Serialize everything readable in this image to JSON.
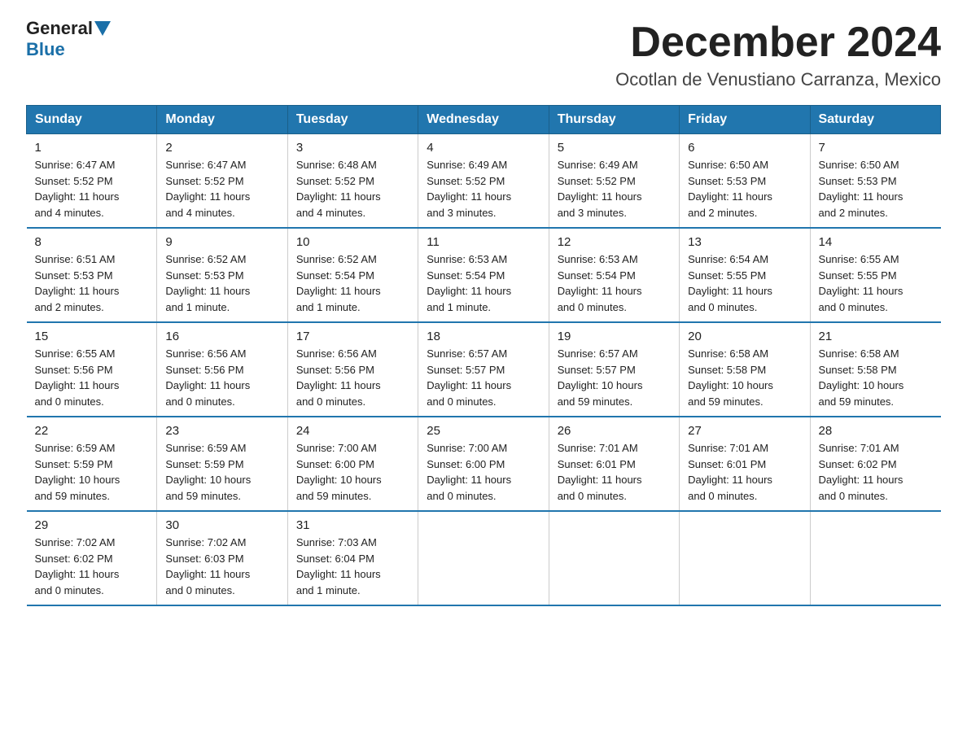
{
  "header": {
    "logo_general": "General",
    "logo_blue": "Blue",
    "main_title": "December 2024",
    "subtitle": "Ocotlan de Venustiano Carranza, Mexico"
  },
  "days_of_week": [
    "Sunday",
    "Monday",
    "Tuesday",
    "Wednesday",
    "Thursday",
    "Friday",
    "Saturday"
  ],
  "weeks": [
    [
      {
        "day": "1",
        "info": "Sunrise: 6:47 AM\nSunset: 5:52 PM\nDaylight: 11 hours\nand 4 minutes."
      },
      {
        "day": "2",
        "info": "Sunrise: 6:47 AM\nSunset: 5:52 PM\nDaylight: 11 hours\nand 4 minutes."
      },
      {
        "day": "3",
        "info": "Sunrise: 6:48 AM\nSunset: 5:52 PM\nDaylight: 11 hours\nand 4 minutes."
      },
      {
        "day": "4",
        "info": "Sunrise: 6:49 AM\nSunset: 5:52 PM\nDaylight: 11 hours\nand 3 minutes."
      },
      {
        "day": "5",
        "info": "Sunrise: 6:49 AM\nSunset: 5:52 PM\nDaylight: 11 hours\nand 3 minutes."
      },
      {
        "day": "6",
        "info": "Sunrise: 6:50 AM\nSunset: 5:53 PM\nDaylight: 11 hours\nand 2 minutes."
      },
      {
        "day": "7",
        "info": "Sunrise: 6:50 AM\nSunset: 5:53 PM\nDaylight: 11 hours\nand 2 minutes."
      }
    ],
    [
      {
        "day": "8",
        "info": "Sunrise: 6:51 AM\nSunset: 5:53 PM\nDaylight: 11 hours\nand 2 minutes."
      },
      {
        "day": "9",
        "info": "Sunrise: 6:52 AM\nSunset: 5:53 PM\nDaylight: 11 hours\nand 1 minute."
      },
      {
        "day": "10",
        "info": "Sunrise: 6:52 AM\nSunset: 5:54 PM\nDaylight: 11 hours\nand 1 minute."
      },
      {
        "day": "11",
        "info": "Sunrise: 6:53 AM\nSunset: 5:54 PM\nDaylight: 11 hours\nand 1 minute."
      },
      {
        "day": "12",
        "info": "Sunrise: 6:53 AM\nSunset: 5:54 PM\nDaylight: 11 hours\nand 0 minutes."
      },
      {
        "day": "13",
        "info": "Sunrise: 6:54 AM\nSunset: 5:55 PM\nDaylight: 11 hours\nand 0 minutes."
      },
      {
        "day": "14",
        "info": "Sunrise: 6:55 AM\nSunset: 5:55 PM\nDaylight: 11 hours\nand 0 minutes."
      }
    ],
    [
      {
        "day": "15",
        "info": "Sunrise: 6:55 AM\nSunset: 5:56 PM\nDaylight: 11 hours\nand 0 minutes."
      },
      {
        "day": "16",
        "info": "Sunrise: 6:56 AM\nSunset: 5:56 PM\nDaylight: 11 hours\nand 0 minutes."
      },
      {
        "day": "17",
        "info": "Sunrise: 6:56 AM\nSunset: 5:56 PM\nDaylight: 11 hours\nand 0 minutes."
      },
      {
        "day": "18",
        "info": "Sunrise: 6:57 AM\nSunset: 5:57 PM\nDaylight: 11 hours\nand 0 minutes."
      },
      {
        "day": "19",
        "info": "Sunrise: 6:57 AM\nSunset: 5:57 PM\nDaylight: 10 hours\nand 59 minutes."
      },
      {
        "day": "20",
        "info": "Sunrise: 6:58 AM\nSunset: 5:58 PM\nDaylight: 10 hours\nand 59 minutes."
      },
      {
        "day": "21",
        "info": "Sunrise: 6:58 AM\nSunset: 5:58 PM\nDaylight: 10 hours\nand 59 minutes."
      }
    ],
    [
      {
        "day": "22",
        "info": "Sunrise: 6:59 AM\nSunset: 5:59 PM\nDaylight: 10 hours\nand 59 minutes."
      },
      {
        "day": "23",
        "info": "Sunrise: 6:59 AM\nSunset: 5:59 PM\nDaylight: 10 hours\nand 59 minutes."
      },
      {
        "day": "24",
        "info": "Sunrise: 7:00 AM\nSunset: 6:00 PM\nDaylight: 10 hours\nand 59 minutes."
      },
      {
        "day": "25",
        "info": "Sunrise: 7:00 AM\nSunset: 6:00 PM\nDaylight: 11 hours\nand 0 minutes."
      },
      {
        "day": "26",
        "info": "Sunrise: 7:01 AM\nSunset: 6:01 PM\nDaylight: 11 hours\nand 0 minutes."
      },
      {
        "day": "27",
        "info": "Sunrise: 7:01 AM\nSunset: 6:01 PM\nDaylight: 11 hours\nand 0 minutes."
      },
      {
        "day": "28",
        "info": "Sunrise: 7:01 AM\nSunset: 6:02 PM\nDaylight: 11 hours\nand 0 minutes."
      }
    ],
    [
      {
        "day": "29",
        "info": "Sunrise: 7:02 AM\nSunset: 6:02 PM\nDaylight: 11 hours\nand 0 minutes."
      },
      {
        "day": "30",
        "info": "Sunrise: 7:02 AM\nSunset: 6:03 PM\nDaylight: 11 hours\nand 0 minutes."
      },
      {
        "day": "31",
        "info": "Sunrise: 7:03 AM\nSunset: 6:04 PM\nDaylight: 11 hours\nand 1 minute."
      },
      {
        "day": "",
        "info": ""
      },
      {
        "day": "",
        "info": ""
      },
      {
        "day": "",
        "info": ""
      },
      {
        "day": "",
        "info": ""
      }
    ]
  ]
}
